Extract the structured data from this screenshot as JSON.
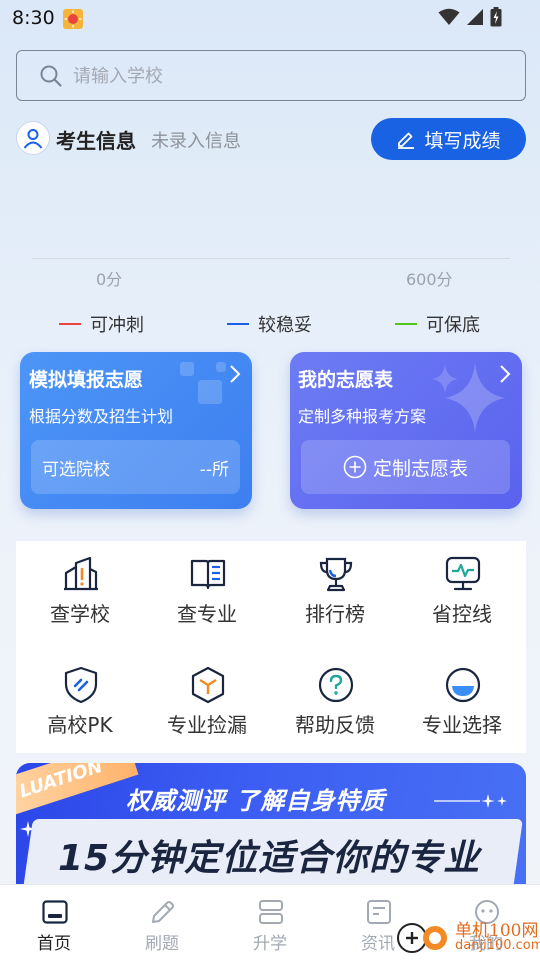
{
  "status_bar": {
    "time": "8:30"
  },
  "search": {
    "placeholder": "请输入学校",
    "value": ""
  },
  "candidate": {
    "title": "考生信息",
    "subtitle": "未录入信息",
    "button_label": "填写成绩"
  },
  "score_scale": {
    "min_label": "0分",
    "max_label": "600分"
  },
  "legend": [
    {
      "label": "可冲刺",
      "color": "#e8453c"
    },
    {
      "label": "较稳妥",
      "color": "#1962e4"
    },
    {
      "label": "可保底",
      "color": "#52c41a"
    }
  ],
  "cards": {
    "left": {
      "title": "模拟填报志愿",
      "subtitle": "根据分数及招生计划",
      "inner_label": "可选院校",
      "inner_value": "--所"
    },
    "right": {
      "title": "我的志愿表",
      "subtitle": "定制多种报考方案",
      "action_label": "定制志愿表"
    }
  },
  "grid": [
    {
      "label": "查学校",
      "icon": "school-building-icon"
    },
    {
      "label": "查专业",
      "icon": "open-book-icon"
    },
    {
      "label": "排行榜",
      "icon": "trophy-icon"
    },
    {
      "label": "省控线",
      "icon": "monitor-pulse-icon"
    },
    {
      "label": "高校PK",
      "icon": "shield-icon"
    },
    {
      "label": "专业捡漏",
      "icon": "cube-icon"
    },
    {
      "label": "帮助反馈",
      "icon": "question-icon"
    },
    {
      "label": "专业选择",
      "icon": "half-circle-icon"
    }
  ],
  "banner": {
    "tag": "LUATION",
    "top_text": "权威测评 了解自身特质",
    "main_text": "15分钟定位适合你的专业"
  },
  "bottom_nav": [
    {
      "label": "首页",
      "icon": "home-icon",
      "active": true
    },
    {
      "label": "刷题",
      "icon": "pencil-icon",
      "active": false
    },
    {
      "label": "升学",
      "icon": "stack-icon",
      "active": false
    },
    {
      "label": "资讯",
      "icon": "news-icon",
      "active": false
    },
    {
      "label": "我的",
      "icon": "smiley-icon",
      "active": false
    }
  ],
  "watermark": {
    "line1": "单机100网",
    "line2": "danji100.com"
  },
  "colors": {
    "primary": "#1962e4",
    "card_left": "#4589f5",
    "card_right": "#636ff1",
    "icon_blue": "#1962e4",
    "icon_orange": "#f28a26",
    "icon_green": "#1fa89a"
  }
}
